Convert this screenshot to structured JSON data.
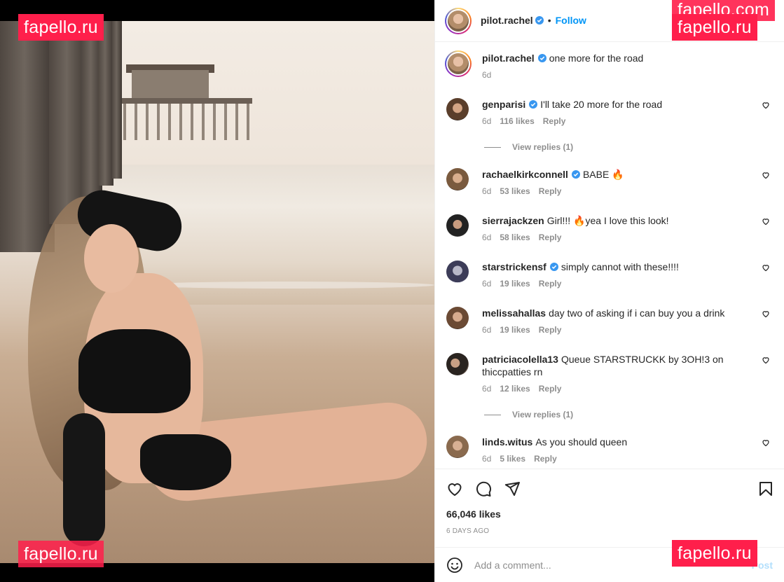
{
  "post": {
    "username": "pilot.rachel",
    "follow_label": "Follow",
    "dot": "•",
    "caption": "one more for the road",
    "caption_age": "6d",
    "likes": "66,046 likes",
    "date": "6 DAYS AGO"
  },
  "watermarks": {
    "top_right_partial": "fapello.com",
    "brand": "fapello.ru"
  },
  "comments": [
    {
      "username": "genparisi",
      "verified": true,
      "text": "I'll take 20 more for the road",
      "age": "6d",
      "likes": "116 likes",
      "reply": "Reply",
      "view_replies": "View replies (1)"
    },
    {
      "username": "rachaelkirkconnell",
      "verified": true,
      "text": "BABE 🔥",
      "age": "6d",
      "likes": "53 likes",
      "reply": "Reply"
    },
    {
      "username": "sierrajackzen",
      "verified": false,
      "text": "Girl!!! 🔥yea I love this look!",
      "age": "6d",
      "likes": "58 likes",
      "reply": "Reply"
    },
    {
      "username": "starstrickensf",
      "verified": true,
      "text": "simply cannot with these!!!!",
      "age": "6d",
      "likes": "19 likes",
      "reply": "Reply"
    },
    {
      "username": "melissahallas",
      "verified": false,
      "text": "day two of asking if i can buy you a drink",
      "age": "6d",
      "likes": "19 likes",
      "reply": "Reply"
    },
    {
      "username": "patriciacolella13",
      "verified": false,
      "text": "Queue STARSTRUCKK by 3OH!3 on thiccpatties rn",
      "age": "6d",
      "likes": "12 likes",
      "reply": "Reply",
      "view_replies": "View replies (1)"
    },
    {
      "username": "linds.witus",
      "verified": false,
      "text": "As you should queen",
      "age": "6d",
      "likes": "5 likes",
      "reply": "Reply"
    }
  ],
  "composer": {
    "placeholder": "Add a comment...",
    "post_label": "Post"
  },
  "icons": {
    "like": "heart-icon",
    "comment": "comment-icon",
    "share": "send-icon",
    "save": "bookmark-icon",
    "emoji": "emoji-icon",
    "verified": "verified-badge-icon"
  },
  "colors": {
    "accent": "#0095f6",
    "watermark": "#ff1f4b",
    "muted": "#8e8e8e"
  }
}
